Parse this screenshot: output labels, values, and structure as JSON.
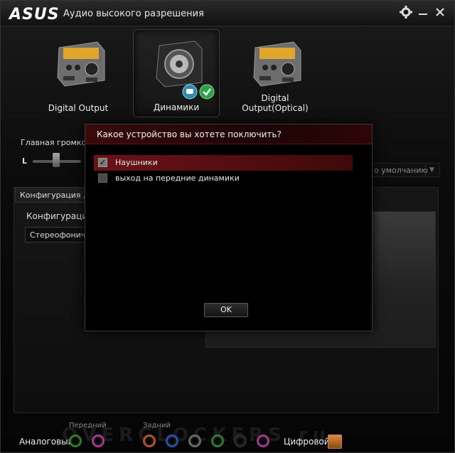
{
  "titlebar": {
    "logo": "ASUS",
    "title": "Аудио высокого разрешения",
    "settings_icon": "gear-icon",
    "minimize_icon": "minimize-icon",
    "close_icon": "close-icon"
  },
  "devices": [
    {
      "label": "Digital Output",
      "icon": "digital-output-device-icon",
      "selected": false
    },
    {
      "label": "Динамики",
      "icon": "speaker-device-icon",
      "selected": true
    },
    {
      "label": "Digital Output(Optical)",
      "icon": "optical-output-device-icon",
      "selected": false
    }
  ],
  "volume": {
    "label": "Главная громкость",
    "left_channel": "L"
  },
  "default_dropdown": {
    "text": "о умолчанию"
  },
  "config": {
    "tab_label": "Конфигурация дин",
    "field_label": "Конфигурация д",
    "selected_value": "Стереофоничес"
  },
  "dialog": {
    "title": "Какое устройство вы хотете поключить?",
    "options": [
      {
        "label": "Наушники",
        "checked": true
      },
      {
        "label": "выход на передние динамики",
        "checked": false
      }
    ],
    "ok_label": "OK"
  },
  "bottom": {
    "analog_label": "Аналоговый",
    "front_label": "Передний",
    "rear_label": "Задний",
    "digital_label": "Цифровой",
    "watermark": "OVERCLOCKERS.ru"
  },
  "colors": {
    "accent_red": "#6b1317",
    "jack_green": "#2f7a2f",
    "jack_pink": "#a03a8a",
    "jack_orange": "#b5532a",
    "jack_blue": "#2a4fa8",
    "jack_gray": "#6a6a6a",
    "jack_black": "#2a2a2a"
  }
}
